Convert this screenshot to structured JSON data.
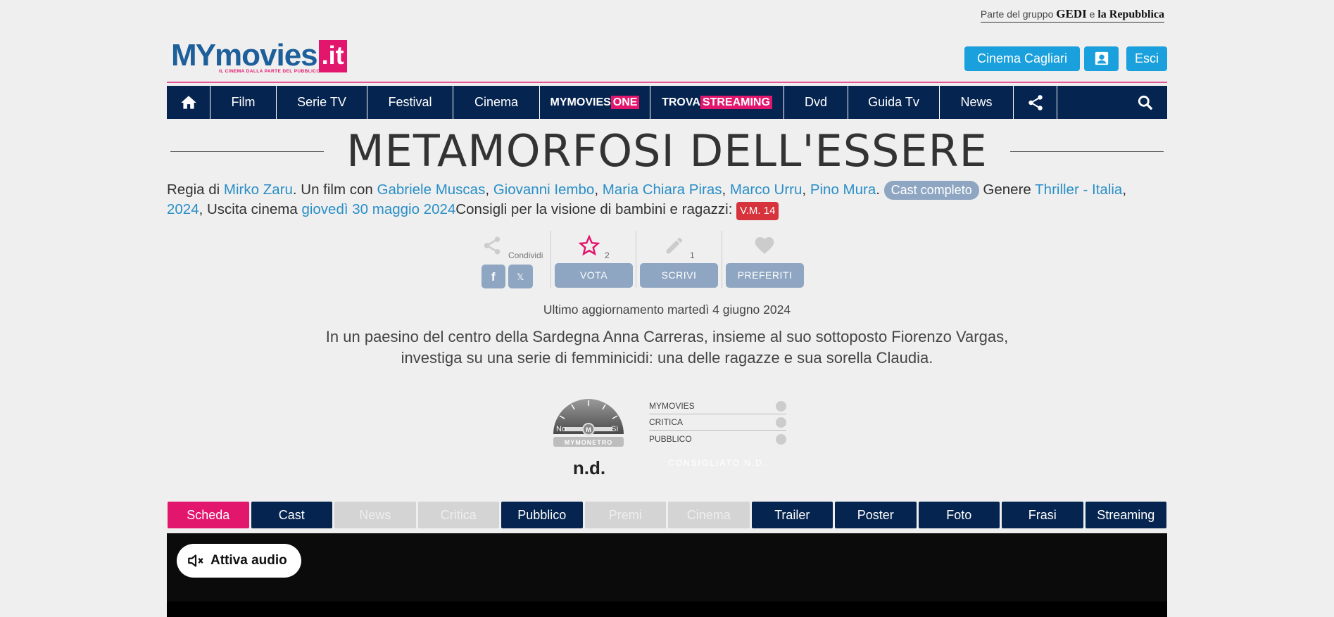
{
  "header": {
    "group_prefix": "Parte del gruppo",
    "group_gedi": "GEDI",
    "group_and": "e",
    "group_repubblica": "la Repubblica",
    "logo_my": "MY",
    "logo_movies": "movies",
    "logo_it": ".it",
    "logo_tagline": "IL CINEMA DALLA PARTE DEL PUBBLICO",
    "cinema_button": "Cinema Cagliari",
    "exit_button": "Esci",
    "account_icon": "account-icon"
  },
  "nav": {
    "home_icon": "home-icon",
    "items": [
      "Film",
      "Serie TV",
      "Festival",
      "Cinema"
    ],
    "mymoviesone_a": "MYMOVIES",
    "mymoviesone_b": "ONE",
    "trovastreaming_a": "TROVA",
    "trovastreaming_b": "STREAMING",
    "items2": [
      "Dvd",
      "Guida Tv",
      "News"
    ],
    "share_icon": "share-icon",
    "search_icon": "search-icon"
  },
  "movie": {
    "title": "METAMORFOSI DELL'ESSERE",
    "regia_label": "Regia di",
    "director": "Mirko Zaru",
    "film_con": ". Un film con",
    "cast": [
      "Gabriele Muscas",
      "Giovanni Iembo",
      "Maria Chiara Piras",
      "Marco Urru",
      "Pino Mura"
    ],
    "cast_button": "Cast completo",
    "genere_label": "Genere",
    "genre": "Thriller",
    "country": "Italia",
    "year": "2024",
    "uscita_label": ", Uscita cinema",
    "release": "giovedì 30 maggio 2024",
    "consigli_label": "Consigli per la visione di bambini e ragazzi:",
    "rating_badge": "V.M. 14",
    "updated": "Ultimo aggiornamento martedì 4 giugno 2024",
    "plot_line1": "In un paesino del centro della Sardegna Anna Carreras, insieme al suo sottoposto Fiorenzo Vargas,",
    "plot_line2": "investiga su una serie di femminicidi: una delle ragazze e sua sorella Claudia."
  },
  "actions": {
    "share_label": "Condividi",
    "facebook": "f",
    "x": "𝕏",
    "vota": "VOTA",
    "vota_count": "2",
    "scrivi": "SCRIVI",
    "scrivi_count": "1",
    "preferiti": "PREFERITI"
  },
  "meter": {
    "no": "No",
    "si": "Sì",
    "brand": "MYMONETRO",
    "score": "n.d.",
    "rows": [
      "MYMOVIES",
      "CRITICA",
      "PUBBLICO"
    ],
    "consigliato": "CONSIGLIATO N.D."
  },
  "tabs": [
    {
      "label": "Scheda",
      "state": "active"
    },
    {
      "label": "Cast",
      "state": "normal"
    },
    {
      "label": "News",
      "state": "disabled"
    },
    {
      "label": "Critica",
      "state": "disabled"
    },
    {
      "label": "Pubblico",
      "state": "normal"
    },
    {
      "label": "Premi",
      "state": "disabled"
    },
    {
      "label": "Cinema",
      "state": "disabled"
    },
    {
      "label": "Trailer",
      "state": "normal"
    },
    {
      "label": "Poster",
      "state": "normal"
    },
    {
      "label": "Foto",
      "state": "normal"
    },
    {
      "label": "Frasi",
      "state": "normal"
    },
    {
      "label": "Streaming",
      "state": "normal"
    }
  ],
  "video": {
    "audio_button": "Attiva audio",
    "mute_icon": "speaker-muted-icon"
  },
  "colors": {
    "brand_pink": "#e3166e",
    "nav_navy": "#05244f",
    "link_blue": "#2a8fc7",
    "button_blue": "#1aa0dc"
  }
}
